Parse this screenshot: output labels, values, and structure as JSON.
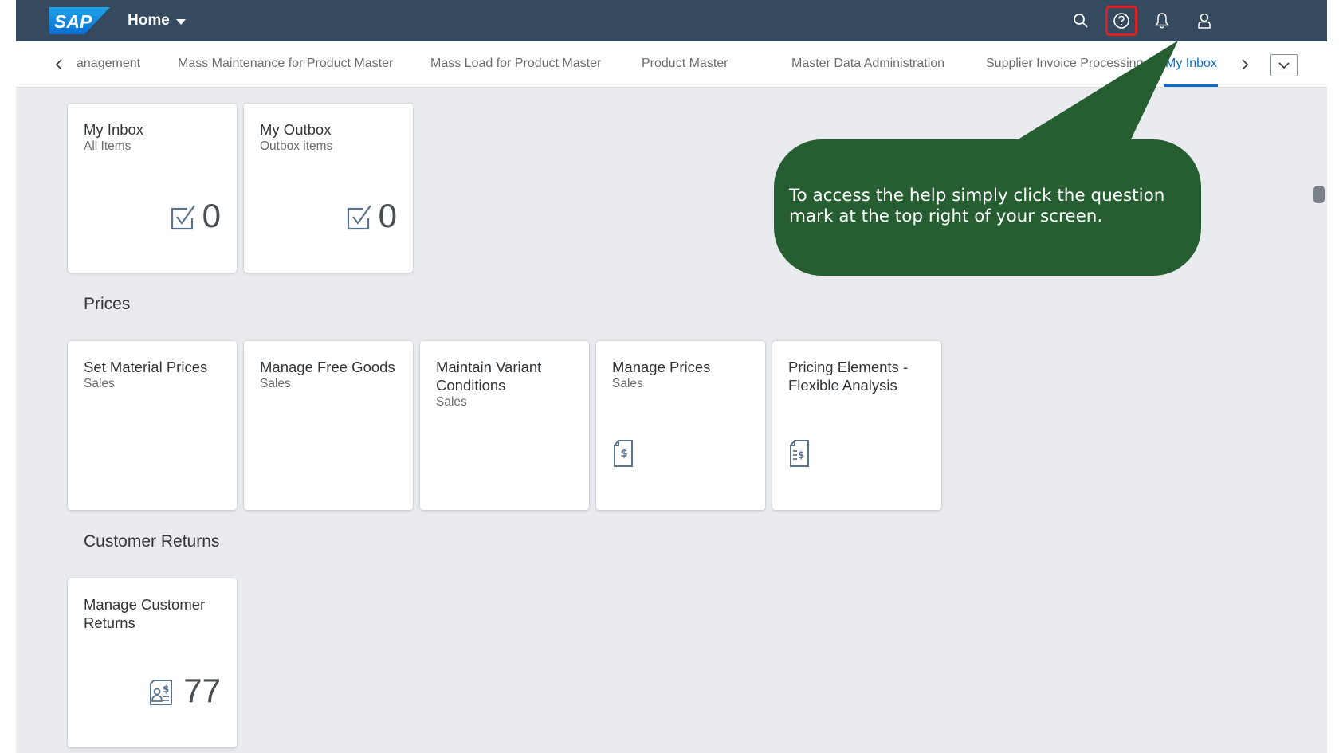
{
  "shell": {
    "home_label": "Home",
    "logo_text": "SAP"
  },
  "tabs": {
    "items": [
      {
        "label": "anagement"
      },
      {
        "label": "Mass Maintenance for Product Master"
      },
      {
        "label": "Mass Load for Product Master"
      },
      {
        "label": "Product Master"
      },
      {
        "label": "Master Data Administration"
      },
      {
        "label": "Supplier Invoice Processing"
      },
      {
        "label": "My Inbox",
        "active": true
      }
    ]
  },
  "groups": {
    "inbox": {
      "tiles": [
        {
          "title": "My Inbox",
          "subtitle": "All Items",
          "value": "0",
          "icon": "task-check-icon"
        },
        {
          "title": "My Outbox",
          "subtitle": "Outbox items",
          "value": "0",
          "icon": "task-check-icon"
        }
      ]
    },
    "prices": {
      "title": "Prices",
      "tiles": [
        {
          "title": "Set Material Prices",
          "subtitle": "Sales"
        },
        {
          "title": "Manage Free Goods",
          "subtitle": "Sales"
        },
        {
          "title": "Maintain Variant Conditions",
          "subtitle": "Sales"
        },
        {
          "title": "Manage Prices",
          "subtitle": "Sales",
          "icon": "price-document-icon"
        },
        {
          "title": "Pricing Elements - Flexible Analysis",
          "subtitle": "",
          "icon": "pricing-analysis-icon"
        }
      ]
    },
    "returns": {
      "title": "Customer Returns",
      "tiles": [
        {
          "title": "Manage Customer Returns",
          "subtitle": "",
          "value": "77",
          "icon": "customer-returns-icon"
        }
      ]
    }
  },
  "callout": {
    "text": "To access the help simply click the question mark at the top right of your screen.",
    "color": "#265e32"
  },
  "colors": {
    "shell": "#354a5f",
    "accent": "#0a6ed1",
    "highlight": "#e02020"
  }
}
